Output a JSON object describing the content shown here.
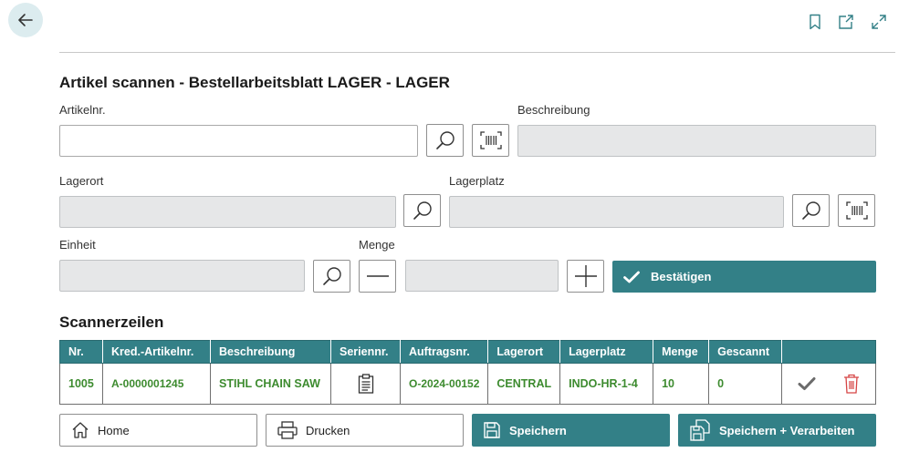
{
  "header": {
    "title": "Artikel scannen - Bestellarbeitsblatt LAGER - LAGER"
  },
  "form": {
    "artikelnr": {
      "label": "Artikelnr.",
      "value": ""
    },
    "beschreibung": {
      "label": "Beschreibung",
      "value": ""
    },
    "lagerort": {
      "label": "Lagerort",
      "value": ""
    },
    "lagerplatz": {
      "label": "Lagerplatz",
      "value": ""
    },
    "einheit": {
      "label": "Einheit",
      "value": ""
    },
    "menge": {
      "label": "Menge",
      "value": ""
    },
    "confirm_label": "Bestätigen"
  },
  "scanner": {
    "title": "Scannerzeilen",
    "columns": [
      "Nr.",
      "Kred.-Artikelnr.",
      "Beschreibung",
      "Seriennr.",
      "Auftragsnr.",
      "Lagerort",
      "Lagerplatz",
      "Menge",
      "Gescannt",
      ""
    ],
    "rows": [
      {
        "nr": "1005",
        "kred_artikelnr": "A-0000001245",
        "beschreibung": "STIHL CHAIN SAW",
        "auftragsnr": "O-2024-00152",
        "lagerort": "CENTRAL",
        "lagerplatz": "INDO-HR-1-4",
        "menge": "10",
        "gescannt": "0"
      }
    ]
  },
  "footer": {
    "home_label": "Home",
    "print_label": "Drucken",
    "save_label": "Speichern",
    "save_process_label": "Speichern + Verarbeiten"
  },
  "colors": {
    "accent": "#338087",
    "value_green": "#3d8b2f",
    "delete_red": "#d64545",
    "back_bg": "#dcecef"
  },
  "icons": {
    "back": "arrow-left-icon",
    "bookmark": "bookmark-icon",
    "open_new": "open-in-new-icon",
    "expand": "expand-icon",
    "search": "search-icon",
    "barcode": "barcode-scan-icon",
    "minus": "minus-icon",
    "plus": "plus-icon",
    "check": "check-icon",
    "clipboard": "clipboard-icon",
    "delete": "trash-icon",
    "home": "home-icon",
    "print": "printer-icon",
    "save": "save-icon",
    "save_process": "save-process-icon"
  }
}
